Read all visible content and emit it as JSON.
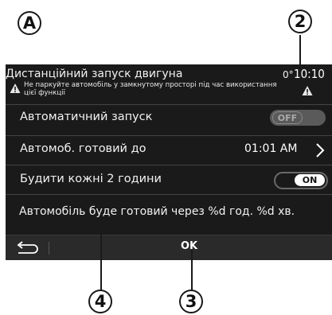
{
  "callouts": {
    "a": "A",
    "two": "2",
    "three": "3",
    "four": "4"
  },
  "header": {
    "title": "Дистанційний запуск двигуна",
    "temperature": "0°",
    "clock": "10:10",
    "warning": "Не паркуйте автомобіль у замкнутому просторі під час використання цієї функції",
    "warning_icon": "warning-triangle-icon"
  },
  "rows": {
    "auto_start": {
      "label": "Автоматичний запуск",
      "toggle": "OFF"
    },
    "ready_by": {
      "label": "Автомоб. готовий до",
      "value": "01:01 AM",
      "icon": "chevron-right-icon"
    },
    "wake": {
      "label": "Будити кожні 2 години",
      "toggle": "ON"
    }
  },
  "info": {
    "text": "Автомобіль буде готовий через %d год. %d хв."
  },
  "bottombar": {
    "back_icon": "back-arrow-icon",
    "ok_label": "OK"
  }
}
